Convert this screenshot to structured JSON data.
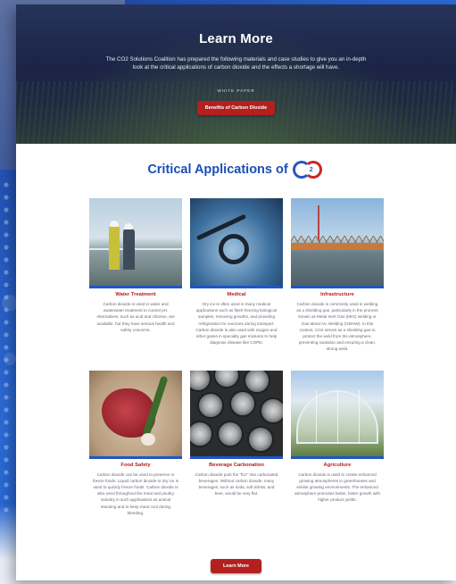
{
  "hero": {
    "title": "Learn More",
    "description": "The CO2 Solutions Coalition has prepared the following materials and case studies to give you an in-depth look at the critical applications of carbon dioxide and the effects a shortage will have.",
    "white_paper_label": "WHITE PAPER",
    "white_paper_button": "Benefits of Carbon Dioxide"
  },
  "section": {
    "title": "Critical Applications of",
    "logo_text": "CO2"
  },
  "applications": [
    {
      "title": "Water Treatment",
      "text": "Carbon dioxide is used in water and wastewater treatment to control pH. Alternatives, such as acid and chlorine, are available, but they have serious health and safety concerns."
    },
    {
      "title": "Medical",
      "text": "Dry ice is often used in many medical applications such as flash freezing biological samples, removing growths, and providing refrigeration for vaccines during transport. Carbon dioxide is also used with oxygen and other gases in specialty gas mixtures to help diagnose disease like COPD."
    },
    {
      "title": "Infrastructure",
      "text": "Carbon dioxide is commonly used in welding as a shielding gas, particularly in the process known as Metal Inert Gas (MIG) welding or Gas Metal Arc Welding (GMAW). In this context, CO2 serves as a shielding gas to protect the weld from the atmosphere, preventing oxidation and ensuring a clean, strong weld."
    },
    {
      "title": "Food Safety",
      "text": "Carbon dioxide can be used to preserve or freeze foods. Liquid carbon dioxide or dry ice is used to quickly freeze foods. Carbon dioxide is also used throughout the meat and poultry industry in such applications as animal stunning and to keep meat cool during blending."
    },
    {
      "title": "Beverage Carbonation",
      "text": "Carbon dioxide puts the “fizz” into carbonated beverages. Without carbon dioxide, many beverages, such as soda, soft drinks, and beer, would be very flat."
    },
    {
      "title": "Agriculture",
      "text": "Carbon dioxide is used to create enhanced growing atmospheres in greenhouses and similar growing environments. The enhanced atmosphere promotes better, faster growth with higher product yields."
    }
  ],
  "footer_button": "Learn More",
  "colors": {
    "accent_red": "#b3201f",
    "accent_blue": "#1b4fb7",
    "hero_bg": "#1b2446"
  }
}
